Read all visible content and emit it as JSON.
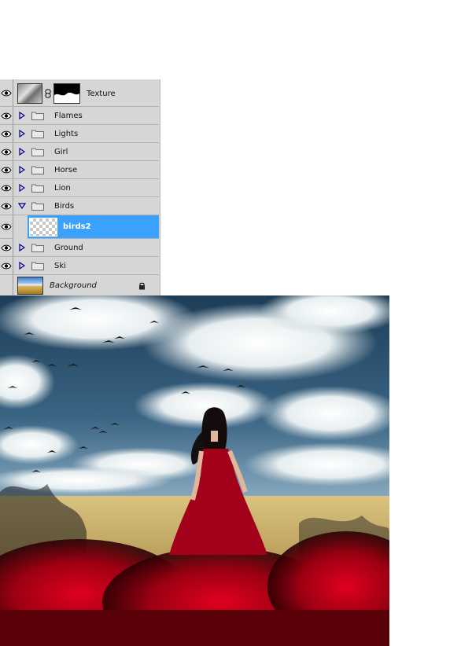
{
  "layers_panel": {
    "layers": [
      {
        "name": "Texture",
        "kind": "layer-with-mask",
        "visible": true
      },
      {
        "name": "Flames",
        "kind": "group",
        "expanded": false,
        "visible": true
      },
      {
        "name": "Lights",
        "kind": "group",
        "expanded": false,
        "visible": true
      },
      {
        "name": "Girl",
        "kind": "group",
        "expanded": false,
        "visible": true
      },
      {
        "name": "Horse",
        "kind": "group",
        "expanded": false,
        "visible": true
      },
      {
        "name": "Lion",
        "kind": "group",
        "expanded": false,
        "visible": true
      },
      {
        "name": "Birds",
        "kind": "group",
        "expanded": true,
        "visible": true
      },
      {
        "name": "birds2",
        "kind": "layer",
        "selected": true,
        "visible": true
      },
      {
        "name": "Ground",
        "kind": "group",
        "expanded": false,
        "visible": true
      },
      {
        "name": "Ski",
        "kind": "group",
        "expanded": false,
        "visible": true
      },
      {
        "name": "Background",
        "kind": "background",
        "locked": true,
        "visible": false
      }
    ]
  },
  "colors": {
    "panel_bg": "#d6d6d6",
    "selection": "#3aa1ff",
    "dress_red": "#b3001b",
    "sky_blue": "#2f5a7a"
  }
}
